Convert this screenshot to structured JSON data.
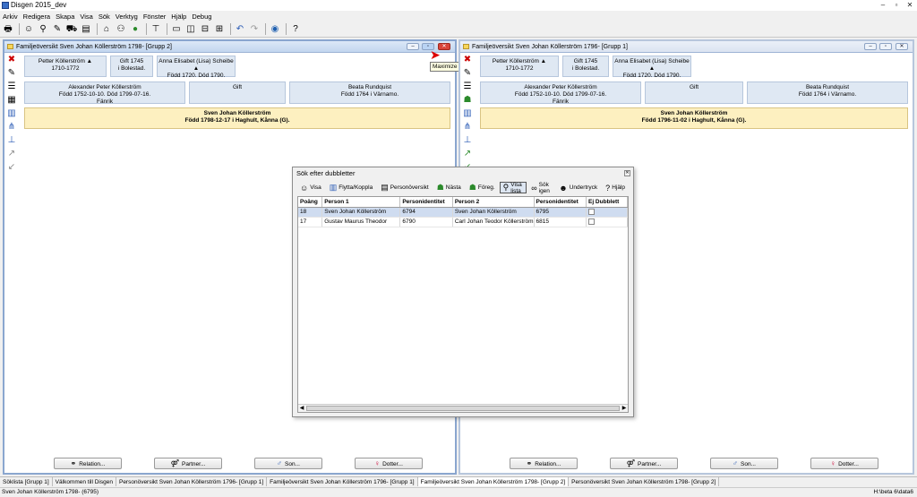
{
  "app": {
    "title": "Disgen 2015_dev"
  },
  "menu": [
    "Arkiv",
    "Redigera",
    "Skapa",
    "Visa",
    "Sök",
    "Verktyg",
    "Fönster",
    "Hjälp",
    "Debug"
  ],
  "toolbar_icons": [
    "print-icon",
    "person-icon",
    "search-person-icon",
    "edit-icon",
    "car-icon",
    "book-icon",
    "house-icon",
    "group-icon",
    "globe-green-icon",
    "tree-icon",
    "layout-single-icon",
    "layout-split-vertical-icon",
    "layout-split-horizontal-icon",
    "layout-grid-icon",
    "undo-icon",
    "redo-icon",
    "internet-icon",
    "help-icon"
  ],
  "left_window": {
    "title": "Familjeöversikt Sven Johan Köllerström 1798- [Grupp 2]",
    "tooltip": "Maximize",
    "grandparents": [
      {
        "line1": "Petter Köllerström ▲",
        "line2": "1710-1772"
      },
      {
        "line1": "Gift 1745",
        "line2": "i Bolestad."
      },
      {
        "line1": "Anna Elisabet (Lisa) Scheibe ▲",
        "line2": "Född 1720. Död 1790."
      }
    ],
    "parents": [
      {
        "line1": "Alexander Peter Köllerström",
        "line2": "Född 1752-10-10. Död 1799-07-16.",
        "line3": "Fänrik"
      },
      {
        "line1": "Gift",
        "line2": "",
        "line3": ""
      },
      {
        "line1": "Beata Rundquist",
        "line2": "Född 1764 i Värnamo.",
        "line3": ""
      }
    ],
    "main": {
      "line1": "Sven Johan Köllerström",
      "line2": "Född 1798-12-17 i Haghult, Kånna (G)."
    },
    "buttons": {
      "relation": "Relation...",
      "partner": "Partner...",
      "son": "Son...",
      "dotter": "Dotter..."
    }
  },
  "right_window": {
    "title": "Familjeöversikt Sven Johan Köllerström 1796- [Grupp 1]",
    "grandparents": [
      {
        "line1": "Petter Köllerström ▲",
        "line2": "1710-1772"
      },
      {
        "line1": "Gift 1745",
        "line2": "i Bolestad."
      },
      {
        "line1": "Anna Elisabet (Lisa) Scheibe ▲",
        "line2": "Född 1720. Död 1790."
      }
    ],
    "parents": [
      {
        "line1": "Alexander Peter Köllerström",
        "line2": "Född 1752-10-10. Död 1799-07-16.",
        "line3": "Fänrik"
      },
      {
        "line1": "Gift",
        "line2": "",
        "line3": ""
      },
      {
        "line1": "Beata Rundquist",
        "line2": "Född 1764 i Värnamo.",
        "line3": ""
      }
    ],
    "main": {
      "line1": "Sven Johan Köllerström",
      "line2": "Född 1796-11-02 i Haghult, Kånna (G)."
    },
    "buttons": {
      "relation": "Relation...",
      "partner": "Partner...",
      "son": "Son...",
      "dotter": "Dotter..."
    }
  },
  "dialog": {
    "title": "Sök efter dubbletter",
    "tools": [
      {
        "label": "Visa",
        "icon": "eye-person-icon"
      },
      {
        "label": "Flytta/Koppla",
        "icon": "merge-icon"
      },
      {
        "label": "Personöversikt",
        "icon": "document-icon"
      },
      {
        "label": "Nästa",
        "icon": "next-icon"
      },
      {
        "label": "Föreg.",
        "icon": "previous-icon"
      },
      {
        "label": "Visa lista",
        "icon": "list-search-icon"
      },
      {
        "label": "Sök igen",
        "icon": "binoculars-icon"
      },
      {
        "label": "Undertryck",
        "icon": "suppress-icon"
      },
      {
        "label": "Hjälp",
        "icon": "help-icon"
      }
    ],
    "columns": [
      "Poäng",
      "Person 1",
      "Personidentitet",
      "Person 2",
      "Personidentitet",
      "Ej Dubblett"
    ],
    "rows": [
      {
        "score": "18",
        "p1": "Sven Johan Köllerström",
        "id1": "6794",
        "p2": "Sven Johan Köllerström",
        "id2": "6795"
      },
      {
        "score": "17",
        "p1": "Gustav Maurus Theodor",
        "id1": "6790",
        "p2": "Carl Johan Teodor Köllerström",
        "id2": "6815"
      }
    ]
  },
  "tabs": [
    "Söklista [Grupp 1]",
    "Välkommen till Disgen",
    "Personöversikt Sven Johan Köllerström 1796- [Grupp 1]",
    "Familjeöversikt Sven Johan Köllerström 1796- [Grupp 1]",
    "Familjeöversikt Sven Johan Köllerström 1798- [Grupp 2]",
    "Personöversikt Sven Johan Köllerström 1798- [Grupp 2]"
  ],
  "status": {
    "left": "Sven Johan Köllerström 1798- (6795)",
    "right": "H:\\beta 6\\data6"
  }
}
